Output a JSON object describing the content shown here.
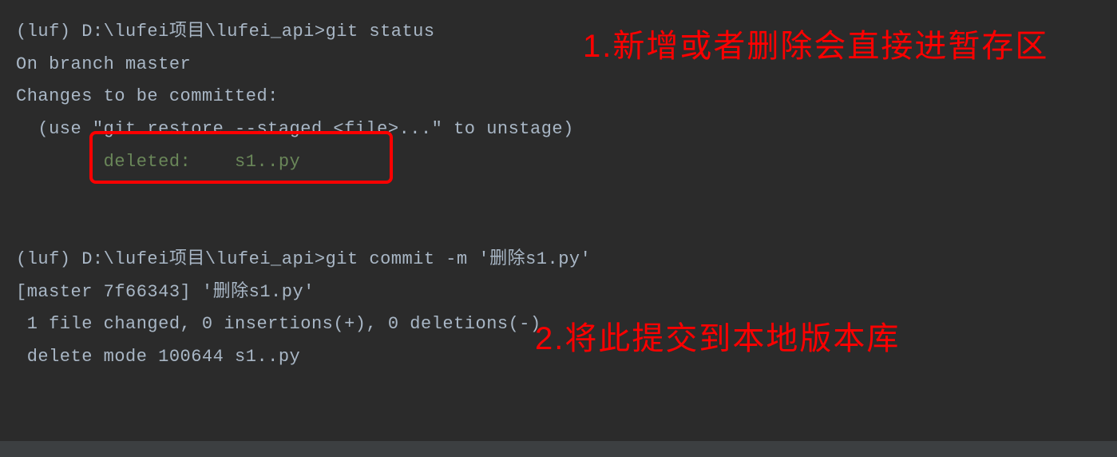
{
  "terminal": {
    "line1_prefix": "(luf) D:\\lufei项目\\lufei_api>",
    "line1_cmd": "git status",
    "line2": "On branch master",
    "line3": "Changes to be committed:",
    "line4": "  (use \"git restore --staged <file>...\" to unstage)",
    "line5_deleted": "        deleted:    s1..py",
    "line6_prefix": "(luf) D:\\lufei项目\\lufei_api>",
    "line6_cmd": "git commit -m '删除s1.py'",
    "line7": "[master 7f66343] '删除s1.py'",
    "line8": " 1 file changed, 0 insertions(+), 0 deletions(-)",
    "line9": " delete mode 100644 s1..py"
  },
  "annotations": {
    "note1": "1.新增或者删除会直接进暂存区",
    "note2": "2.将此提交到本地版本库"
  }
}
